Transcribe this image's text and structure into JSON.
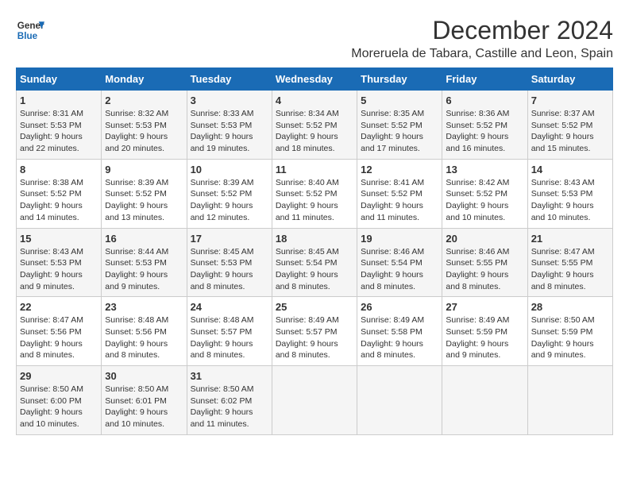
{
  "header": {
    "logo_line1": "General",
    "logo_line2": "Blue",
    "title": "December 2024",
    "subtitle": "Moreruela de Tabara, Castille and Leon, Spain"
  },
  "calendar": {
    "days_of_week": [
      "Sunday",
      "Monday",
      "Tuesday",
      "Wednesday",
      "Thursday",
      "Friday",
      "Saturday"
    ],
    "weeks": [
      [
        null,
        {
          "day": "2",
          "sunrise": "Sunrise: 8:32 AM",
          "sunset": "Sunset: 5:53 PM",
          "daylight": "Daylight: 9 hours and 20 minutes."
        },
        {
          "day": "3",
          "sunrise": "Sunrise: 8:33 AM",
          "sunset": "Sunset: 5:53 PM",
          "daylight": "Daylight: 9 hours and 19 minutes."
        },
        {
          "day": "4",
          "sunrise": "Sunrise: 8:34 AM",
          "sunset": "Sunset: 5:52 PM",
          "daylight": "Daylight: 9 hours and 18 minutes."
        },
        {
          "day": "5",
          "sunrise": "Sunrise: 8:35 AM",
          "sunset": "Sunset: 5:52 PM",
          "daylight": "Daylight: 9 hours and 17 minutes."
        },
        {
          "day": "6",
          "sunrise": "Sunrise: 8:36 AM",
          "sunset": "Sunset: 5:52 PM",
          "daylight": "Daylight: 9 hours and 16 minutes."
        },
        {
          "day": "7",
          "sunrise": "Sunrise: 8:37 AM",
          "sunset": "Sunset: 5:52 PM",
          "daylight": "Daylight: 9 hours and 15 minutes."
        }
      ],
      [
        {
          "day": "1",
          "sunrise": "Sunrise: 8:31 AM",
          "sunset": "Sunset: 5:53 PM",
          "daylight": "Daylight: 9 hours and 22 minutes."
        },
        null,
        null,
        null,
        null,
        null,
        null
      ],
      [
        {
          "day": "8",
          "sunrise": "Sunrise: 8:38 AM",
          "sunset": "Sunset: 5:52 PM",
          "daylight": "Daylight: 9 hours and 14 minutes."
        },
        {
          "day": "9",
          "sunrise": "Sunrise: 8:39 AM",
          "sunset": "Sunset: 5:52 PM",
          "daylight": "Daylight: 9 hours and 13 minutes."
        },
        {
          "day": "10",
          "sunrise": "Sunrise: 8:39 AM",
          "sunset": "Sunset: 5:52 PM",
          "daylight": "Daylight: 9 hours and 12 minutes."
        },
        {
          "day": "11",
          "sunrise": "Sunrise: 8:40 AM",
          "sunset": "Sunset: 5:52 PM",
          "daylight": "Daylight: 9 hours and 11 minutes."
        },
        {
          "day": "12",
          "sunrise": "Sunrise: 8:41 AM",
          "sunset": "Sunset: 5:52 PM",
          "daylight": "Daylight: 9 hours and 11 minutes."
        },
        {
          "day": "13",
          "sunrise": "Sunrise: 8:42 AM",
          "sunset": "Sunset: 5:52 PM",
          "daylight": "Daylight: 9 hours and 10 minutes."
        },
        {
          "day": "14",
          "sunrise": "Sunrise: 8:43 AM",
          "sunset": "Sunset: 5:53 PM",
          "daylight": "Daylight: 9 hours and 10 minutes."
        }
      ],
      [
        {
          "day": "15",
          "sunrise": "Sunrise: 8:43 AM",
          "sunset": "Sunset: 5:53 PM",
          "daylight": "Daylight: 9 hours and 9 minutes."
        },
        {
          "day": "16",
          "sunrise": "Sunrise: 8:44 AM",
          "sunset": "Sunset: 5:53 PM",
          "daylight": "Daylight: 9 hours and 9 minutes."
        },
        {
          "day": "17",
          "sunrise": "Sunrise: 8:45 AM",
          "sunset": "Sunset: 5:53 PM",
          "daylight": "Daylight: 9 hours and 8 minutes."
        },
        {
          "day": "18",
          "sunrise": "Sunrise: 8:45 AM",
          "sunset": "Sunset: 5:54 PM",
          "daylight": "Daylight: 9 hours and 8 minutes."
        },
        {
          "day": "19",
          "sunrise": "Sunrise: 8:46 AM",
          "sunset": "Sunset: 5:54 PM",
          "daylight": "Daylight: 9 hours and 8 minutes."
        },
        {
          "day": "20",
          "sunrise": "Sunrise: 8:46 AM",
          "sunset": "Sunset: 5:55 PM",
          "daylight": "Daylight: 9 hours and 8 minutes."
        },
        {
          "day": "21",
          "sunrise": "Sunrise: 8:47 AM",
          "sunset": "Sunset: 5:55 PM",
          "daylight": "Daylight: 9 hours and 8 minutes."
        }
      ],
      [
        {
          "day": "22",
          "sunrise": "Sunrise: 8:47 AM",
          "sunset": "Sunset: 5:56 PM",
          "daylight": "Daylight: 9 hours and 8 minutes."
        },
        {
          "day": "23",
          "sunrise": "Sunrise: 8:48 AM",
          "sunset": "Sunset: 5:56 PM",
          "daylight": "Daylight: 9 hours and 8 minutes."
        },
        {
          "day": "24",
          "sunrise": "Sunrise: 8:48 AM",
          "sunset": "Sunset: 5:57 PM",
          "daylight": "Daylight: 9 hours and 8 minutes."
        },
        {
          "day": "25",
          "sunrise": "Sunrise: 8:49 AM",
          "sunset": "Sunset: 5:57 PM",
          "daylight": "Daylight: 9 hours and 8 minutes."
        },
        {
          "day": "26",
          "sunrise": "Sunrise: 8:49 AM",
          "sunset": "Sunset: 5:58 PM",
          "daylight": "Daylight: 9 hours and 8 minutes."
        },
        {
          "day": "27",
          "sunrise": "Sunrise: 8:49 AM",
          "sunset": "Sunset: 5:59 PM",
          "daylight": "Daylight: 9 hours and 9 minutes."
        },
        {
          "day": "28",
          "sunrise": "Sunrise: 8:50 AM",
          "sunset": "Sunset: 5:59 PM",
          "daylight": "Daylight: 9 hours and 9 minutes."
        }
      ],
      [
        {
          "day": "29",
          "sunrise": "Sunrise: 8:50 AM",
          "sunset": "Sunset: 6:00 PM",
          "daylight": "Daylight: 9 hours and 10 minutes."
        },
        {
          "day": "30",
          "sunrise": "Sunrise: 8:50 AM",
          "sunset": "Sunset: 6:01 PM",
          "daylight": "Daylight: 9 hours and 10 minutes."
        },
        {
          "day": "31",
          "sunrise": "Sunrise: 8:50 AM",
          "sunset": "Sunset: 6:02 PM",
          "daylight": "Daylight: 9 hours and 11 minutes."
        },
        null,
        null,
        null,
        null
      ]
    ]
  }
}
